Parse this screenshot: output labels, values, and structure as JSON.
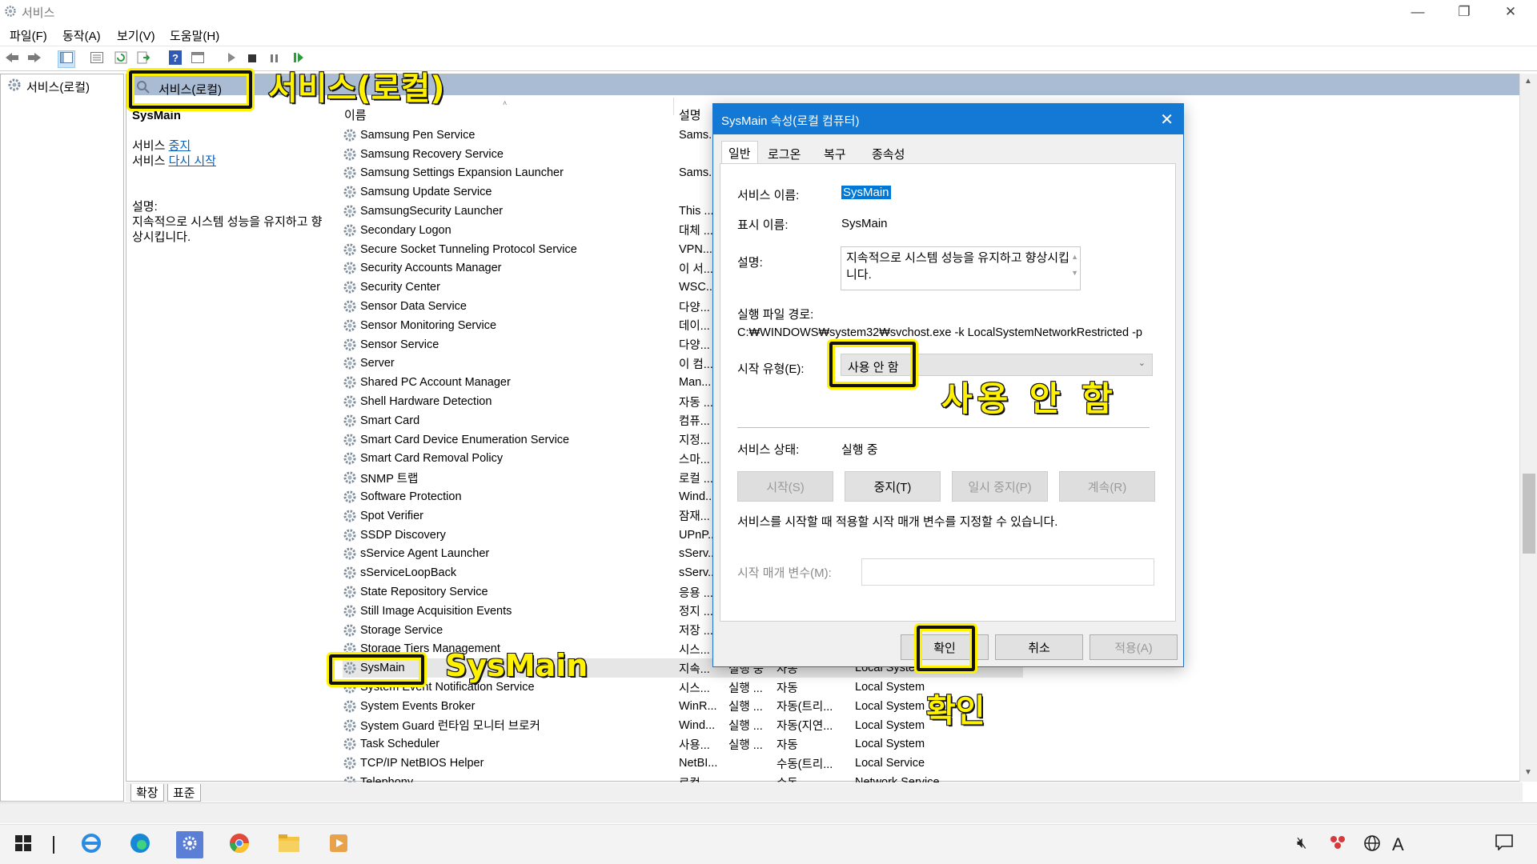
{
  "window": {
    "title": "서비스",
    "minimize_icon": "—",
    "restore_icon": "❐",
    "close_icon": "✕"
  },
  "menu": [
    "파일(F)",
    "동작(A)",
    "보기(V)",
    "도움말(H)"
  ],
  "tree": {
    "root_label": "서비스(로컬)"
  },
  "main_header": {
    "label": "서비스(로컬)"
  },
  "detail": {
    "service_name": "SysMain",
    "stop_prefix": "서비스",
    "stop_link": "중지",
    "restart_prefix": "서비스",
    "restart_link": "다시 시작",
    "desc_label": "설명:",
    "desc_text": "지속적으로 시스템 성능을 유지하고 향상시킵니다."
  },
  "list": {
    "col_name": "이름",
    "col_desc": "설명",
    "rows": [
      {
        "name": "Samsung Pen Service",
        "desc": "Sams...",
        "status": "",
        "stype": "",
        "logon": ""
      },
      {
        "name": "Samsung Recovery Service",
        "desc": "",
        "status": "",
        "stype": "",
        "logon": ""
      },
      {
        "name": "Samsung Settings Expansion Launcher",
        "desc": "Sams...",
        "status": "",
        "stype": "",
        "logon": ""
      },
      {
        "name": "Samsung Update Service",
        "desc": "",
        "status": "",
        "stype": "",
        "logon": ""
      },
      {
        "name": "SamsungSecurity Launcher",
        "desc": "This ...",
        "status": "",
        "stype": "",
        "logon": ""
      },
      {
        "name": "Secondary Logon",
        "desc": "대체 ...",
        "status": "",
        "stype": "",
        "logon": ""
      },
      {
        "name": "Secure Socket Tunneling Protocol Service",
        "desc": "VPN...",
        "status": "",
        "stype": "",
        "logon": ""
      },
      {
        "name": "Security Accounts Manager",
        "desc": "이 서...",
        "status": "",
        "stype": "",
        "logon": ""
      },
      {
        "name": "Security Center",
        "desc": "WSC...",
        "status": "",
        "stype": "",
        "logon": ""
      },
      {
        "name": "Sensor Data Service",
        "desc": "다양...",
        "status": "",
        "stype": "",
        "logon": ""
      },
      {
        "name": "Sensor Monitoring Service",
        "desc": "데이...",
        "status": "",
        "stype": "",
        "logon": ""
      },
      {
        "name": "Sensor Service",
        "desc": "다양...",
        "status": "",
        "stype": "",
        "logon": ""
      },
      {
        "name": "Server",
        "desc": "이 컴...",
        "status": "",
        "stype": "",
        "logon": ""
      },
      {
        "name": "Shared PC Account Manager",
        "desc": "Man...",
        "status": "",
        "stype": "",
        "logon": ""
      },
      {
        "name": "Shell Hardware Detection",
        "desc": "자동 ...",
        "status": "",
        "stype": "",
        "logon": ""
      },
      {
        "name": "Smart Card",
        "desc": "컴퓨...",
        "status": "",
        "stype": "",
        "logon": ""
      },
      {
        "name": "Smart Card Device Enumeration Service",
        "desc": "지정...",
        "status": "",
        "stype": "",
        "logon": ""
      },
      {
        "name": "Smart Card Removal Policy",
        "desc": "스마...",
        "status": "",
        "stype": "",
        "logon": ""
      },
      {
        "name": "SNMP 트랩",
        "desc": "로컬 ...",
        "status": "",
        "stype": "",
        "logon": ""
      },
      {
        "name": "Software Protection",
        "desc": "Wind...",
        "status": "",
        "stype": "",
        "logon": ""
      },
      {
        "name": "Spot Verifier",
        "desc": "잠재...",
        "status": "",
        "stype": "",
        "logon": ""
      },
      {
        "name": "SSDP Discovery",
        "desc": "UPnP...",
        "status": "",
        "stype": "",
        "logon": ""
      },
      {
        "name": "sService Agent Launcher",
        "desc": "sServ...",
        "status": "",
        "stype": "",
        "logon": ""
      },
      {
        "name": "sServiceLoopBack",
        "desc": "sServ...",
        "status": "",
        "stype": "",
        "logon": ""
      },
      {
        "name": "State Repository Service",
        "desc": "응용 ...",
        "status": "",
        "stype": "",
        "logon": ""
      },
      {
        "name": "Still Image Acquisition Events",
        "desc": "정지 ...",
        "status": "",
        "stype": "",
        "logon": ""
      },
      {
        "name": "Storage Service",
        "desc": "저장 ...",
        "status": "",
        "stype": "",
        "logon": ""
      },
      {
        "name": "Storage Tiers Management",
        "desc": "시스...",
        "status": "",
        "stype": "",
        "logon": ""
      },
      {
        "name": "SysMain",
        "desc": "지속...",
        "status": "실행 중",
        "stype": "자동",
        "logon": "Local System"
      },
      {
        "name": "System Event Notification Service",
        "desc": "시스...",
        "status": "실행 ...",
        "stype": "자동",
        "logon": "Local System"
      },
      {
        "name": "System Events Broker",
        "desc": "WinR...",
        "status": "실행 ...",
        "stype": "자동(트리...",
        "logon": "Local System"
      },
      {
        "name": "System Guard 런타임 모니터 브로커",
        "desc": "Wind...",
        "status": "실행 ...",
        "stype": "자동(지연...",
        "logon": "Local System"
      },
      {
        "name": "Task Scheduler",
        "desc": "사용...",
        "status": "실행 ...",
        "stype": "자동",
        "logon": "Local System"
      },
      {
        "name": "TCP/IP NetBIOS Helper",
        "desc": "NetBI...",
        "status": "",
        "stype": "수동(트리...",
        "logon": "Local Service"
      },
      {
        "name": "Telephony",
        "desc": "로컬 ...",
        "status": "",
        "stype": "수동",
        "logon": "Network Service"
      }
    ]
  },
  "bottom_tabs": [
    "확장",
    "표준"
  ],
  "dialog": {
    "title": "SysMain 속성(로컬 컴퓨터)",
    "close_icon": "✕",
    "tabs": [
      "일반",
      "로그온",
      "복구",
      "종속성"
    ],
    "service_name_label": "서비스 이름:",
    "service_name_value": "SysMain",
    "display_name_label": "표시 이름:",
    "display_name_value": "SysMain",
    "desc_label": "설명:",
    "desc_value": "지속적으로 시스템 성능을 유지하고 향상시킵니다.",
    "path_label": "실행 파일 경로:",
    "path_value": "C:₩WINDOWS₩system32₩svchost.exe -k LocalSystemNetworkRestricted -p",
    "startup_label": "시작 유형(E):",
    "startup_value": "사용 안 함",
    "status_label": "서비스 상태:",
    "status_value": "실행 중",
    "btn_start": "시작(S)",
    "btn_stop": "중지(T)",
    "btn_pause": "일시 중지(P)",
    "btn_resume": "계속(R)",
    "hint": "서비스를 시작할 때 적용할 시작 매개 변수를 지정할 수 있습니다.",
    "param_label": "시작 매개 변수(M):",
    "param_value": "",
    "btn_ok": "확인",
    "btn_cancel": "취소",
    "btn_apply": "적용(A)"
  },
  "callouts": {
    "services_local": "서비스(로컬)",
    "disabled": "사용 안 함",
    "sysmain": "SysMain",
    "confirm": "확인"
  },
  "tray": {
    "lang": "A"
  },
  "colors": {
    "accent_blue": "#1479d4",
    "callout_yellow": "#fff200",
    "header_band": "#a9bcd4"
  }
}
